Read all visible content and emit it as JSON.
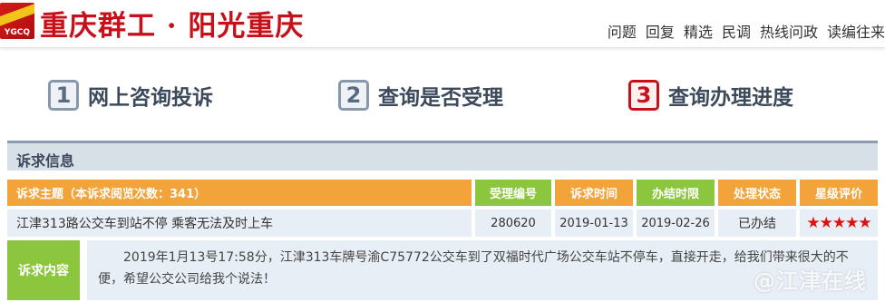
{
  "header": {
    "logo_letters": "YGCQ",
    "title": "重庆群工 · 阳光重庆",
    "nav": [
      "问题",
      "回复",
      "精选",
      "民调",
      "热线问政",
      "读编往来"
    ]
  },
  "steps": [
    {
      "num": "1",
      "label": "网上咨询投诉",
      "active": false
    },
    {
      "num": "2",
      "label": "查询是否受理",
      "active": false
    },
    {
      "num": "3",
      "label": "查询办理进度",
      "active": true
    }
  ],
  "section": {
    "title": "诉求信息"
  },
  "table": {
    "headers": {
      "subject": "诉求主题（本诉求阅览次数：341）",
      "id": "受理编号",
      "time": "诉求时间",
      "deadline": "办结时限",
      "status": "处理状态",
      "rating": "星级评价"
    },
    "row": {
      "subject": "江津313路公交车到站不停 乘客无法及时上车",
      "id": "280620",
      "time": "2019-01-13",
      "deadline": "2019-02-26",
      "status": "已办结",
      "rating": "★★★★★"
    }
  },
  "content": {
    "label": "诉求内容",
    "text": "2019年1月13号17:58分，江津313车牌号渝C75772公交车到了双福时代广场公交车站不停车，直接开走，给我们带来很大的不便，希望公交公司给我个说法！",
    "watermark": "@江津在线"
  },
  "colors": {
    "brand_red": "#c8101a",
    "orange": "#f2a33a",
    "green": "#8cc63e",
    "row_bg": "#e8eef5"
  }
}
